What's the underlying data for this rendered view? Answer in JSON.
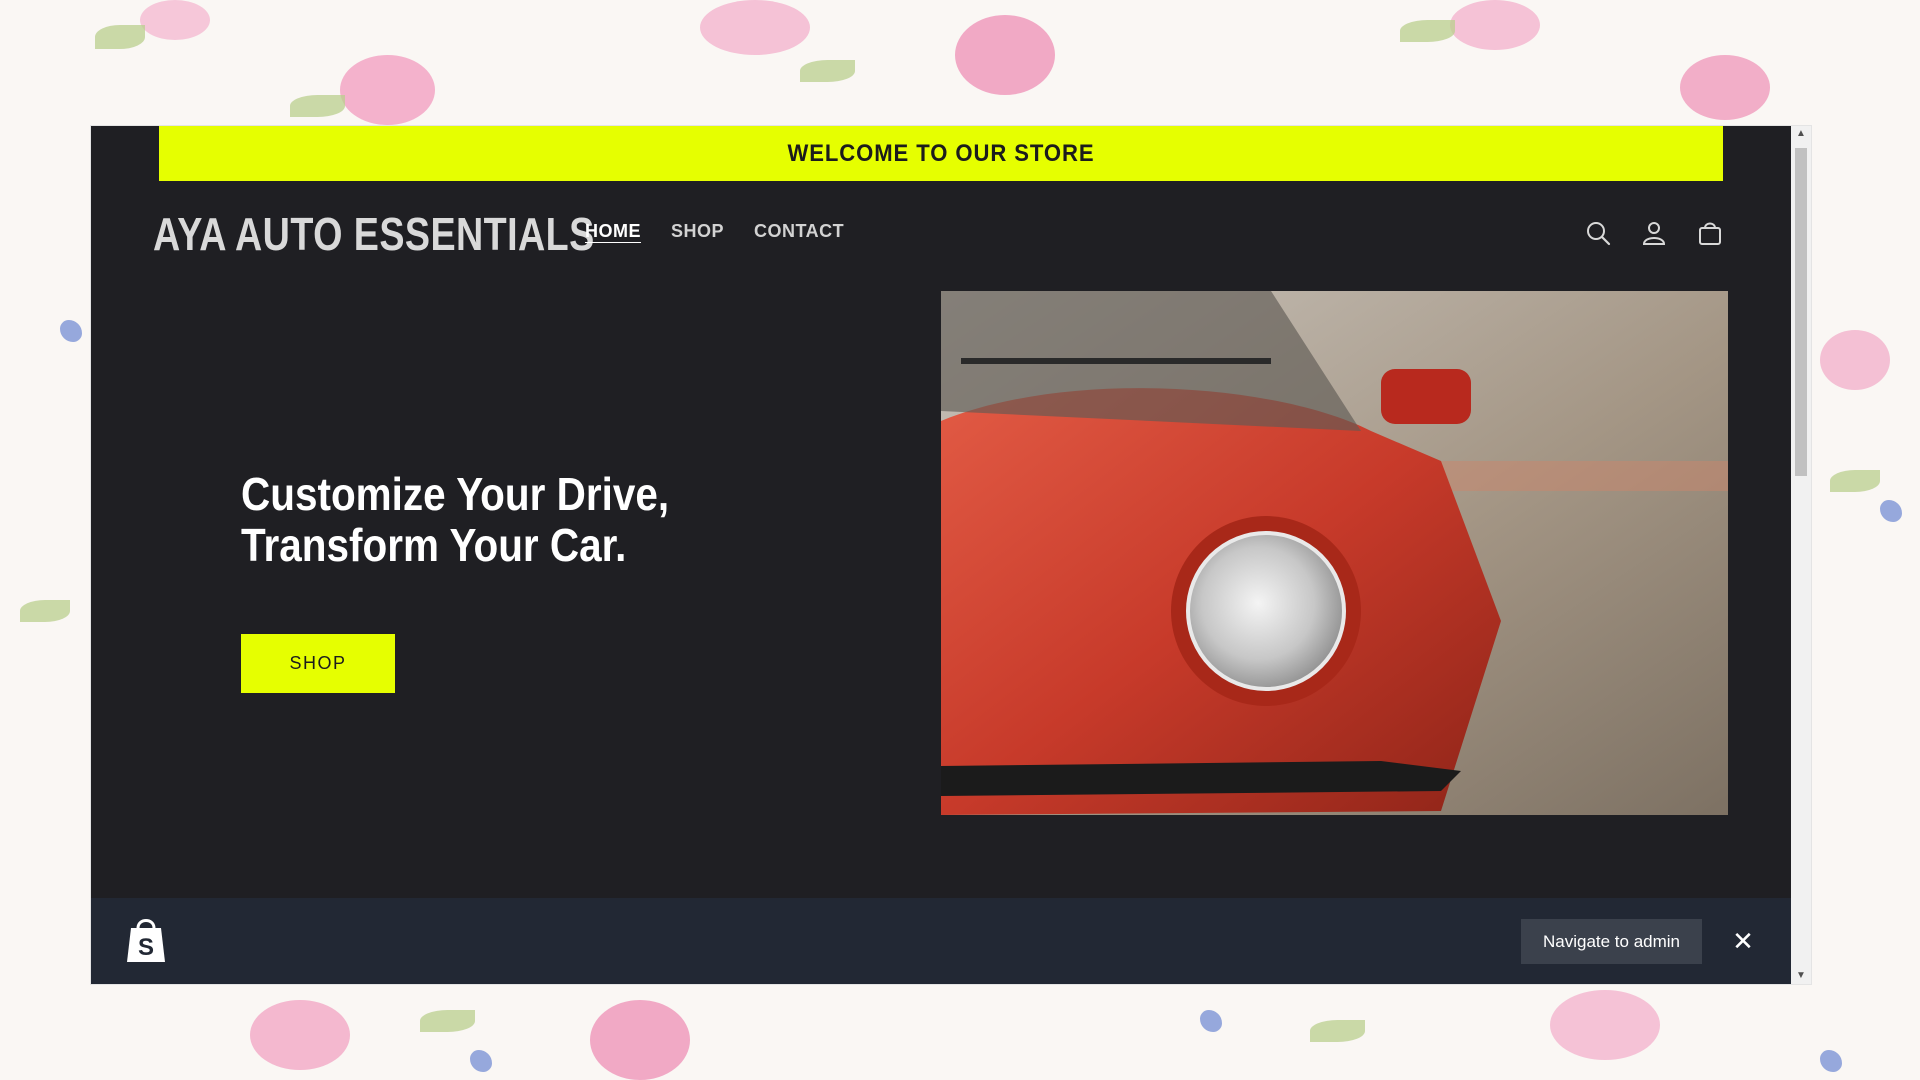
{
  "announcement": {
    "text": "WELCOME TO OUR STORE"
  },
  "header": {
    "logo": "AYA AUTO ESSENTIALS",
    "nav": [
      {
        "label": "HOME",
        "active": true
      },
      {
        "label": "SHOP",
        "active": false
      },
      {
        "label": "CONTACT",
        "active": false
      }
    ],
    "icons": [
      "search-icon",
      "account-icon",
      "cart-icon"
    ]
  },
  "hero": {
    "title": "Customize Your Drive, Transform Your Car.",
    "button_label": "SHOP",
    "image": "red-car-headlight-photo"
  },
  "admin_bar": {
    "button_label": "Navigate to admin",
    "close_symbol": "✕",
    "logo_icon": "shopify-bag-icon"
  },
  "colors": {
    "accent": "#e6ff00",
    "header_bg": "#1f1f23",
    "admin_bar_bg": "#222834"
  }
}
